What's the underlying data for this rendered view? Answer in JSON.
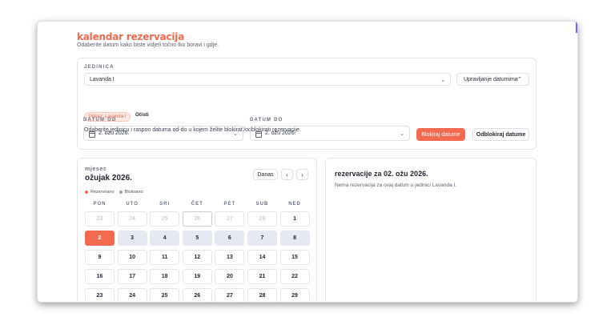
{
  "header": {
    "title": "kalendar rezervacija",
    "subtitle": "Odaberite datum kako biste vidjeli točno tko boravi i gdje."
  },
  "unit": {
    "label": "JEDINICA",
    "selected": "Lavanda I",
    "manage_button": "Upravljanje datumima",
    "chip": "Prikaz: Lavanda I",
    "clear": "Očisti",
    "instructions": "Odaberite jedinicu i raspon datuma od-do u kojem želite blokirati/odblokirati rezervacije."
  },
  "range": {
    "from_label": "DATUM OD",
    "from_value": "2. ožu 2026.",
    "to_label": "DATUM DO",
    "to_value": "2. ožu 2026.",
    "block_button": "Blokiraj datume",
    "unblock_button": "Odblokiraj datume"
  },
  "calendar": {
    "section_label": "mjesec",
    "month": "ožujak 2026.",
    "today_button": "Danas",
    "legend": [
      {
        "label": "Rezervirano",
        "color": "#f26b50"
      },
      {
        "label": "Blokirano",
        "color": "#9aa0ab"
      }
    ],
    "weekdays": [
      "PON",
      "UTO",
      "SRI",
      "ČET",
      "PET",
      "SUB",
      "NED"
    ],
    "days": [
      {
        "n": "23",
        "state": "out"
      },
      {
        "n": "24",
        "state": "out"
      },
      {
        "n": "25",
        "state": "out"
      },
      {
        "n": "26",
        "state": "out-ring"
      },
      {
        "n": "27",
        "state": "out"
      },
      {
        "n": "28",
        "state": "out"
      },
      {
        "n": "1",
        "state": ""
      },
      {
        "n": "2",
        "state": "selected"
      },
      {
        "n": "3",
        "state": "blocked"
      },
      {
        "n": "4",
        "state": "blocked"
      },
      {
        "n": "5",
        "state": "blocked"
      },
      {
        "n": "6",
        "state": "blocked"
      },
      {
        "n": "7",
        "state": "blocked"
      },
      {
        "n": "8",
        "state": "blocked"
      },
      {
        "n": "9",
        "state": ""
      },
      {
        "n": "10",
        "state": ""
      },
      {
        "n": "11",
        "state": ""
      },
      {
        "n": "12",
        "state": ""
      },
      {
        "n": "13",
        "state": ""
      },
      {
        "n": "14",
        "state": ""
      },
      {
        "n": "15",
        "state": ""
      },
      {
        "n": "16",
        "state": ""
      },
      {
        "n": "17",
        "state": ""
      },
      {
        "n": "18",
        "state": ""
      },
      {
        "n": "19",
        "state": ""
      },
      {
        "n": "20",
        "state": ""
      },
      {
        "n": "21",
        "state": ""
      },
      {
        "n": "22",
        "state": ""
      },
      {
        "n": "23",
        "state": ""
      },
      {
        "n": "24",
        "state": ""
      },
      {
        "n": "25",
        "state": ""
      },
      {
        "n": "26",
        "state": ""
      },
      {
        "n": "27",
        "state": ""
      },
      {
        "n": "28",
        "state": ""
      },
      {
        "n": "29",
        "state": ""
      }
    ]
  },
  "reservations": {
    "title": "rezervacije za 02. ožu 2026.",
    "empty_text": "Nema rezervacija za ovaj datum u jedinici Lavanda I."
  }
}
